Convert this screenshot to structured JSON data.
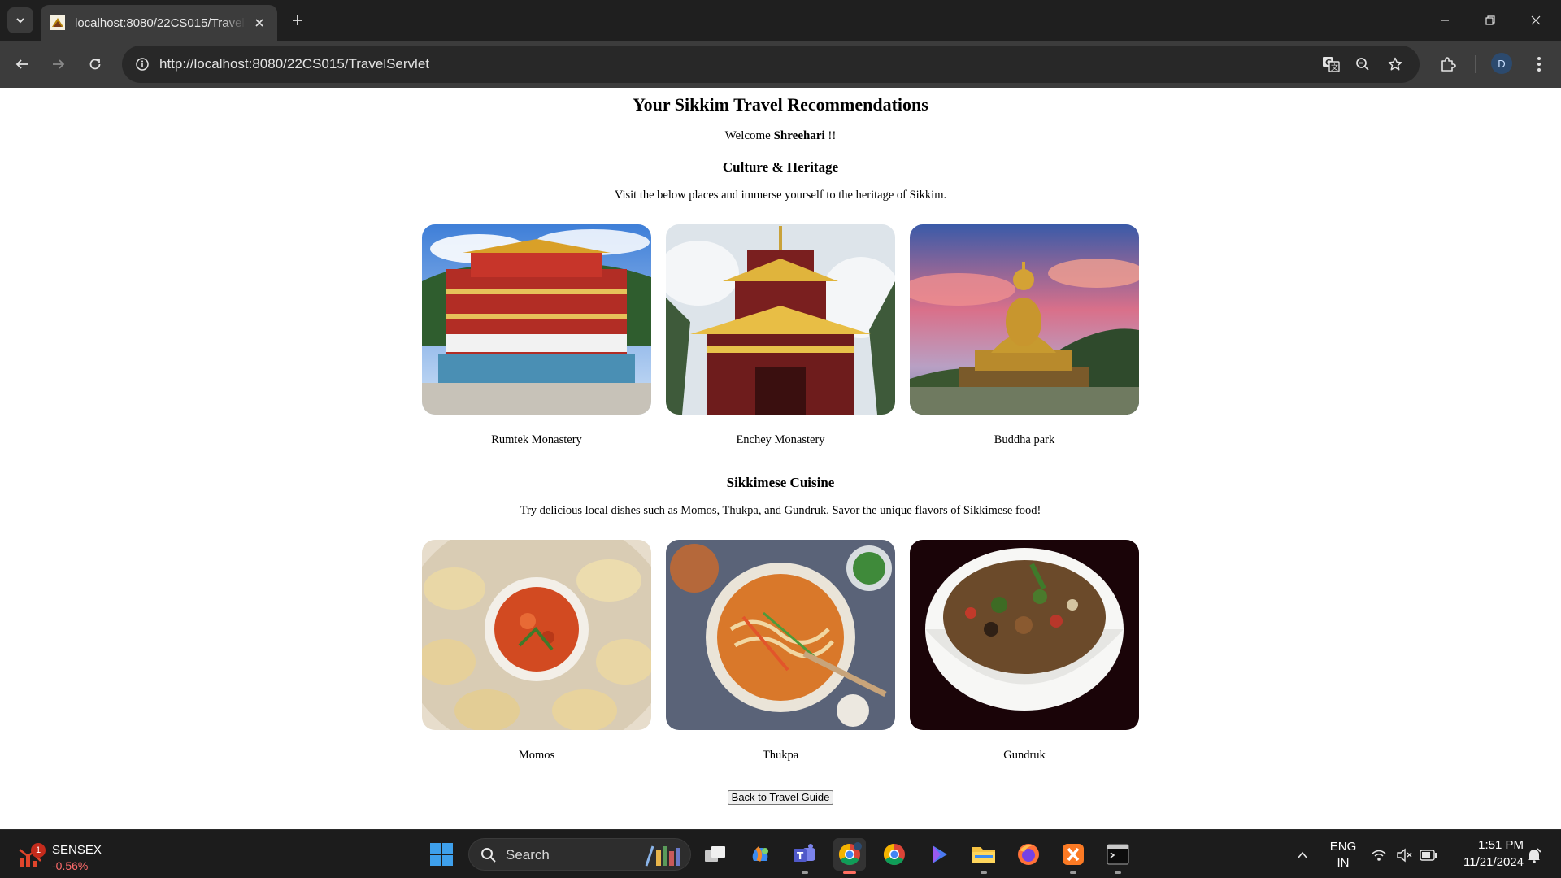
{
  "browser": {
    "tab_title": "localhost:8080/22CS015/TravelServlet",
    "url": "http://localhost:8080/22CS015/TravelServlet",
    "profile_initial": "D",
    "icons": [
      "tab-search-icon",
      "favicon",
      "close-icon",
      "new-tab-icon",
      "minimize-icon",
      "restore-icon",
      "close-window-icon",
      "back-icon",
      "forward-icon",
      "reload-icon",
      "site-info-icon",
      "translate-icon",
      "zoom-icon",
      "bookmark-star-icon",
      "extensions-icon",
      "menu-icon"
    ]
  },
  "page": {
    "heading": "Your Sikkim Travel Recommendations",
    "welcome_prefix": "Welcome ",
    "user_name": "Shreehari",
    "welcome_suffix": " !!",
    "sections": [
      {
        "title": "Culture & Heritage",
        "description": "Visit the below places and immerse yourself to the heritage of Sikkim.",
        "items": [
          {
            "caption": "Rumtek Monastery",
            "image": "monastery-photo"
          },
          {
            "caption": "Enchey Monastery",
            "image": "pagoda-photo"
          },
          {
            "caption": "Buddha park",
            "image": "buddha-statue-photo"
          }
        ]
      },
      {
        "title": "Sikkimese Cuisine",
        "description": "Try delicious local dishes such as Momos, Thukpa, and Gundruk. Savor the unique flavors of Sikkimese food!",
        "items": [
          {
            "caption": "Momos",
            "image": "dumplings-photo"
          },
          {
            "caption": "Thukpa",
            "image": "noodle-soup-photo"
          },
          {
            "caption": "Gundruk",
            "image": "greens-bowl-photo"
          }
        ]
      }
    ],
    "back_button": "Back to Travel Guide"
  },
  "taskbar": {
    "widget_name": "SENSEX",
    "widget_change": "-0.56%",
    "widget_badge": "1",
    "search_label": "Search",
    "language_line1": "ENG",
    "language_line2": "IN",
    "time": "1:51 PM",
    "date": "11/21/2024",
    "colors": {
      "accent_chrome": "#ff6f61",
      "taskbar_bg": "#1c1c1c"
    }
  }
}
